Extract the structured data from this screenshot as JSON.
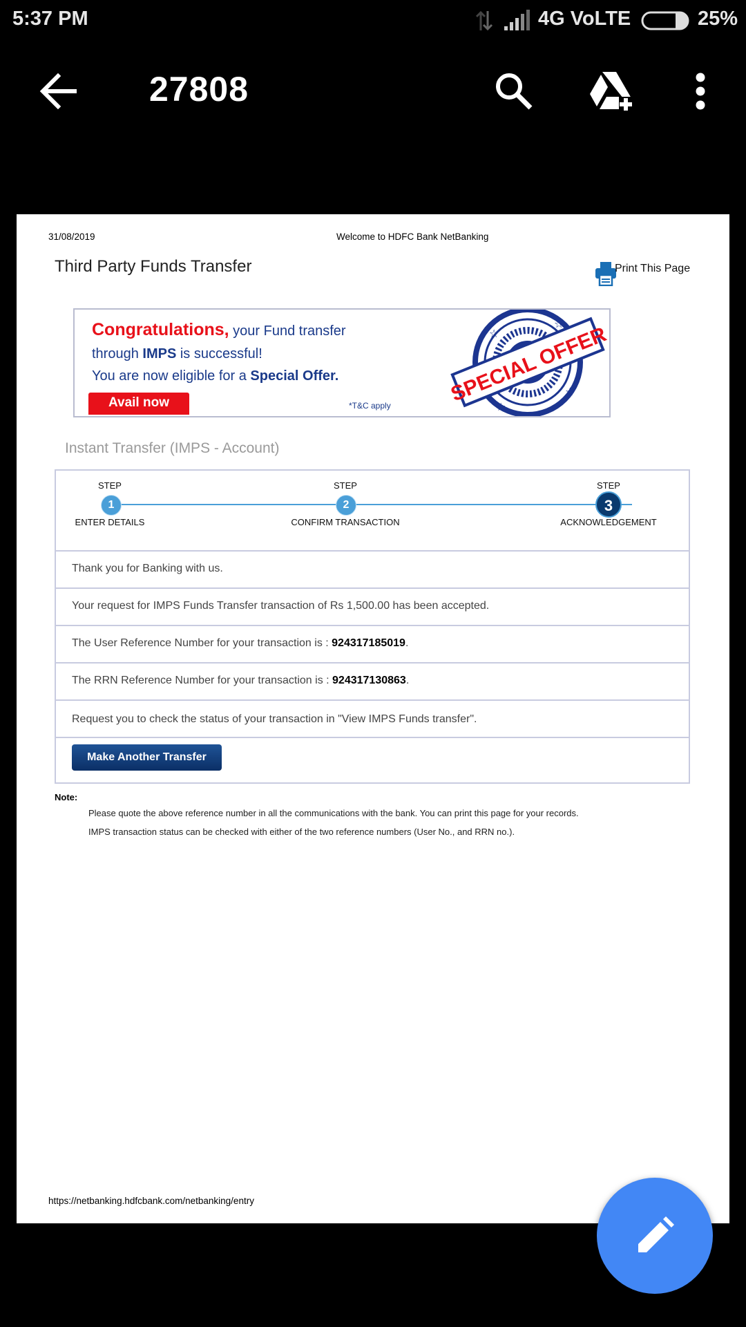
{
  "status_bar": {
    "time": "5:37 PM",
    "network": "4G VoLTE",
    "battery": "25%"
  },
  "toolbar": {
    "title": "27808"
  },
  "document": {
    "date": "31/08/2019",
    "welcome": "Welcome to HDFC Bank NetBanking",
    "heading": "Third Party Funds Transfer",
    "print_label": "Print This Page",
    "banner": {
      "congrats": "Congratulations,",
      "line1_rest": " your Fund transfer",
      "line2_pre": "through ",
      "line2_bold": "IMPS",
      "line2_post": " is successful!",
      "line3_pre": "You are now eligible for a ",
      "line3_bold": "Special Offer.",
      "cta": "Avail now",
      "tnc": "*T&C apply",
      "stamp_main": "SPECIAL OFFER",
      "stamp_ring": "SPECIAL OFFER"
    },
    "section_title": "Instant Transfer (IMPS - Account)",
    "steps": [
      {
        "step_word": "STEP",
        "number": "1",
        "label": "ENTER DETAILS"
      },
      {
        "step_word": "STEP",
        "number": "2",
        "label": "CONFIRM TRANSACTION"
      },
      {
        "step_word": "STEP",
        "number": "3",
        "label": "ACKNOWLEDGEMENT"
      }
    ],
    "messages": {
      "thanks": "Thank you for Banking with us.",
      "accepted": "Your request for IMPS Funds Transfer transaction of Rs 1,500.00 has been accepted.",
      "user_ref_prefix": "The User Reference Number for your transaction is : ",
      "user_ref": "924317185019",
      "rrn_prefix": "The RRN Reference Number for your transaction is : ",
      "rrn_ref": "924317130863",
      "period": ".",
      "check_status": "Request you to check the status of your transaction in \"View IMPS Funds transfer\"."
    },
    "make_another": "Make Another Transfer",
    "note_label": "Note:",
    "note_lines": [
      "Please quote the above reference number in all the communications with the bank. You can print this page for your records.",
      "IMPS transaction status can be checked with either of the two reference numbers (User No., and RRN no.)."
    ],
    "url": "https://netbanking.hdfcbank.com/netbanking/entry"
  },
  "colors": {
    "accent_blue": "#4287f5",
    "step_blue": "#4a9fd8",
    "step_done": "#0a3a6e",
    "cta_red": "#e8111a",
    "banner_blue": "#1a3a8a"
  },
  "icons": [
    "back-arrow-icon",
    "search-icon",
    "drive-add-icon",
    "more-vert-icon",
    "printer-icon",
    "edit-pencil-icon",
    "signal-icon",
    "data-arrows-icon",
    "battery-icon"
  ]
}
